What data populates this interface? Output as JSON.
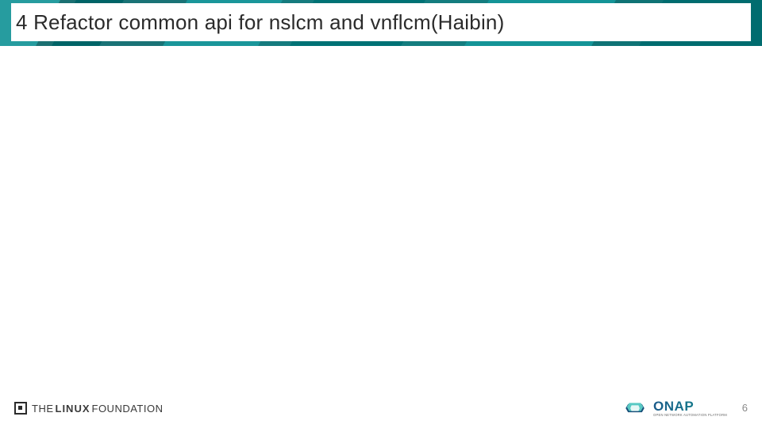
{
  "header": {
    "title": "4 Refactor common api for nslcm and vnflcm(Haibin)"
  },
  "footer": {
    "linux_foundation": {
      "the": "THE",
      "linux": "LINUX",
      "foundation": "FOUNDATION"
    },
    "onap": {
      "word": "ONAP",
      "sub": "OPEN NETWORK AUTOMATION PLATFORM"
    },
    "page_number": "6"
  },
  "colors": {
    "header_teal": "#008b8f",
    "title_text": "#2b2b2b",
    "page_number_grey": "#8a8a8a"
  }
}
